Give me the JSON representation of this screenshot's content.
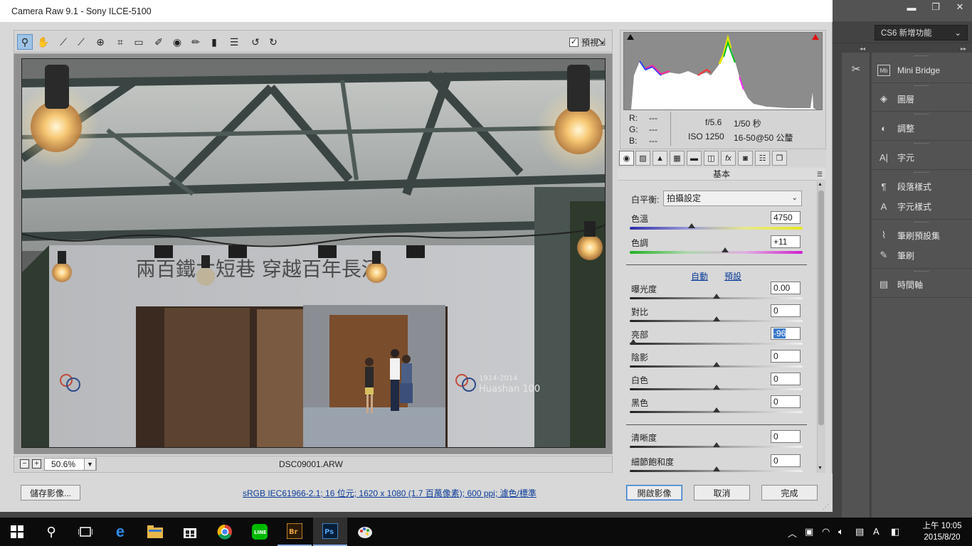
{
  "dialog": {
    "title": "Camera Raw 9.1  -  Sony ILCE-5100",
    "preview_label": "預視",
    "preview_checked": "✓"
  },
  "toolbar": {
    "tools": [
      "zoom-tool",
      "hand-tool",
      "white-balance-tool",
      "color-sampler-tool",
      "targeted-adjustment-tool",
      "crop-tool",
      "straighten-tool",
      "spot-removal-tool",
      "red-eye-tool",
      "adjustment-brush-tool",
      "graduated-filter-tool",
      "radial-filter-tool",
      "preferences",
      "rotate-left",
      "rotate-right"
    ]
  },
  "statusbar": {
    "zoom_minus": "−",
    "zoom_plus": "+",
    "zoom_value": "50.6%",
    "filename": "DSC09001.ARW"
  },
  "photo": {
    "sign_text": "兩百鐵木短巷  穿越百年長河",
    "watermark_year": "1914-2014",
    "watermark_name": "Huashan 100"
  },
  "info": {
    "r_label": "R:",
    "r_value": "---",
    "g_label": "G:",
    "g_value": "---",
    "b_label": "B:",
    "b_value": "---",
    "aperture": "f/5.6",
    "shutter": "1/50 秒",
    "iso": "ISO 1250",
    "lens": "16-50@50 公釐"
  },
  "panel": {
    "title": "基本",
    "tabs": [
      "basic",
      "tone-curve",
      "detail",
      "hsl",
      "split-toning",
      "lens",
      "fx",
      "camera-calibration",
      "presets",
      "snapshots"
    ],
    "wb_label": "白平衡:",
    "wb_value": "拍攝設定",
    "auto_link": "自動",
    "default_link": "預設",
    "sliders": [
      {
        "label": "色溫",
        "value": "4750",
        "pos": 0.36
      },
      {
        "label": "色調",
        "value": "+11",
        "pos": 0.55
      },
      {
        "label": "曝光度",
        "value": "0.00",
        "pos": 0.5
      },
      {
        "label": "對比",
        "value": "0",
        "pos": 0.5
      },
      {
        "label": "亮部",
        "value": "-96",
        "pos": 0.02
      },
      {
        "label": "陰影",
        "value": "0",
        "pos": 0.5
      },
      {
        "label": "白色",
        "value": "0",
        "pos": 0.5
      },
      {
        "label": "黑色",
        "value": "0",
        "pos": 0.5
      },
      {
        "label": "清晰度",
        "value": "0",
        "pos": 0.5
      },
      {
        "label": "細節飽和度",
        "value": "0",
        "pos": 0.5
      }
    ]
  },
  "bottom": {
    "save_button": "儲存影像...",
    "workflow_link": "sRGB IEC61966-2.1; 16 位元; 1620 x 1080 (1.7 百萬像素); 600 ppi; 濾色/標準",
    "open_button": "開啟影像",
    "cancel_button": "取消",
    "done_button": "完成"
  },
  "photoshop": {
    "workspace": "CS6 新增功能",
    "panels": [
      "Mini Bridge",
      "圖層",
      "調整",
      "字元",
      "段落樣式",
      "字元樣式",
      "筆刷預設集",
      "筆刷",
      "時間軸"
    ]
  },
  "taskbar": {
    "time": "上午 10:05",
    "date": "2015/8/20",
    "ime": "A"
  }
}
